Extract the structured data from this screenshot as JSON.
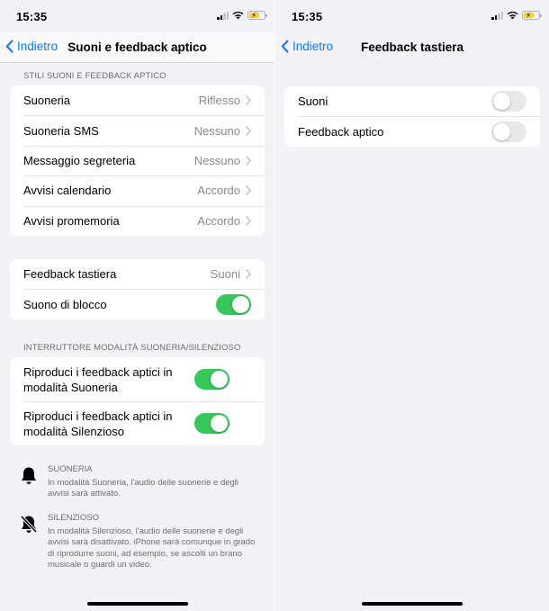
{
  "left": {
    "status": {
      "time": "15:35"
    },
    "nav": {
      "back_label": "Indietro",
      "title": "Suoni e feedback aptico"
    },
    "section1": {
      "header": "STILI SUONI E FEEDBACK APTICO",
      "rows": [
        {
          "label": "Suoneria",
          "value": "Riflesso"
        },
        {
          "label": "Suoneria SMS",
          "value": "Nessuno"
        },
        {
          "label": "Messaggio segreteria",
          "value": "Nessuno"
        },
        {
          "label": "Avvisi calendario",
          "value": "Accordo"
        },
        {
          "label": "Avvisi promemoria",
          "value": "Accordo"
        }
      ]
    },
    "section2": {
      "keyboard_feedback": {
        "label": "Feedback tastiera",
        "value": "Suoni"
      },
      "lock_sound": {
        "label": "Suono di blocco",
        "on": true
      }
    },
    "section3": {
      "header": "INTERRUTTORE MODALITÀ SUONERIA/SILENZIOSO",
      "ring_haptics": {
        "label": "Riproduci i feedback aptici in modalità Suoneria",
        "on": true
      },
      "silent_haptics": {
        "label": "Riproduci i feedback aptici in modalità Silenzioso",
        "on": true
      }
    },
    "info": {
      "ring": {
        "icon": "bell-icon",
        "title": "SUONERIA",
        "text": "In modalità Suoneria, l'audio delle suonerie e degli avvisi sarà attivato."
      },
      "silent": {
        "icon": "bell-slash-icon",
        "title": "SILENZIOSO",
        "text": "In modalità Silenzioso, l'audio delle suonerie e degli avvisi sarà disattivato. iPhone sarà comunque in grado di riprodurre suoni, ad esempio, se ascolti un brano musicale o guardi un video."
      }
    }
  },
  "right": {
    "status": {
      "time": "15:35"
    },
    "nav": {
      "back_label": "Indietro",
      "title": "Feedback tastiera"
    },
    "rows": [
      {
        "label": "Suoni",
        "on": false
      },
      {
        "label": "Feedback aptico",
        "on": false
      }
    ]
  },
  "colors": {
    "accent": "#0a7aff",
    "toggle_on": "#34c759",
    "toggle_off": "#e9e9eb",
    "background": "#f2f2f7",
    "battery_fill": "#f5d337"
  }
}
